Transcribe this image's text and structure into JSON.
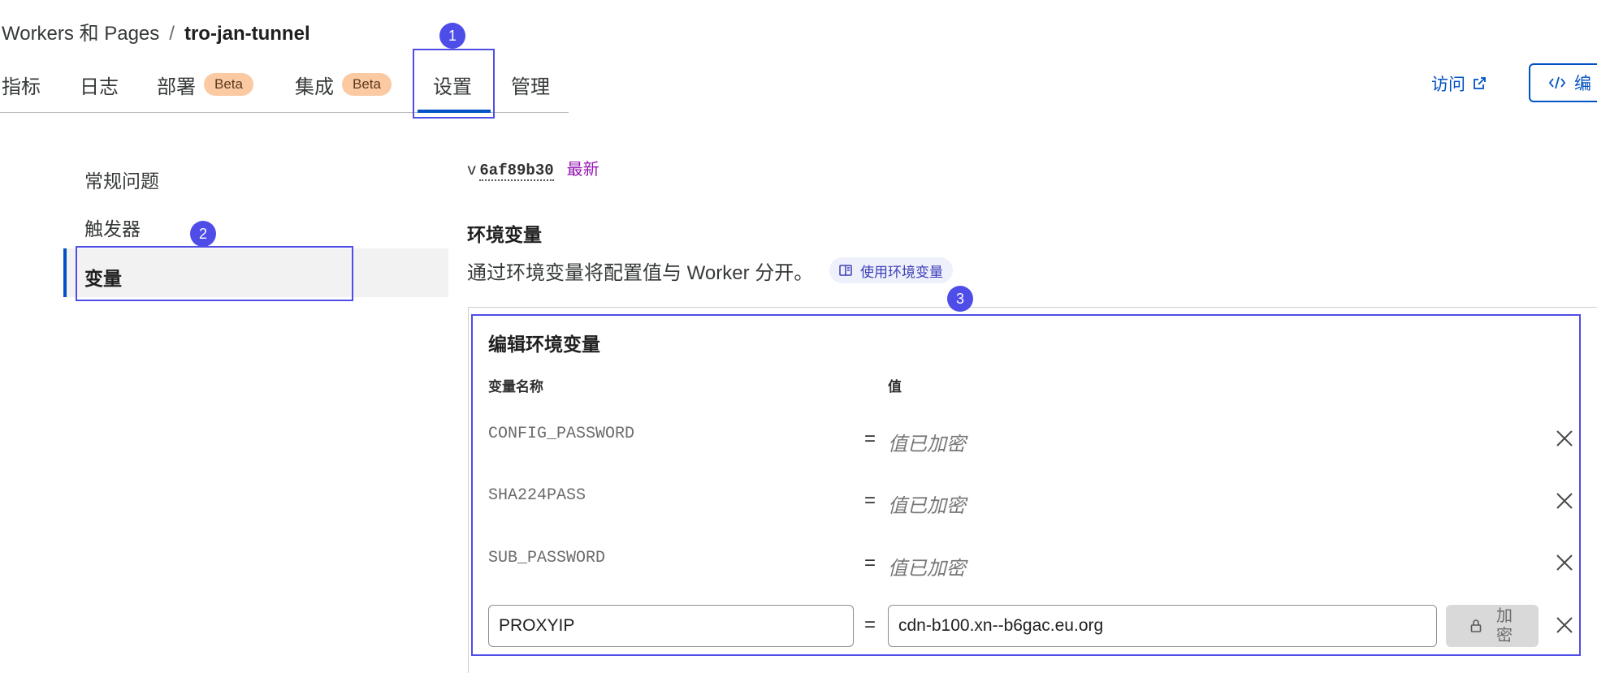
{
  "breadcrumb": {
    "parent": "Workers 和 Pages",
    "separator": "/",
    "current": "tro-jan-tunnel"
  },
  "tabs": [
    {
      "label": "指标"
    },
    {
      "label": "日志"
    },
    {
      "label": "部署",
      "badge": "Beta"
    },
    {
      "label": "集成",
      "badge": "Beta"
    },
    {
      "label": "设置",
      "active": true
    },
    {
      "label": "管理"
    }
  ],
  "header_actions": {
    "visit_label": "访问",
    "edit_label": "编"
  },
  "sidebar": {
    "items": [
      {
        "label": "常规问题"
      },
      {
        "label": "触发器"
      },
      {
        "label": "变量",
        "active": true
      }
    ]
  },
  "version": {
    "prefix": "v",
    "hash": "6af89b30",
    "tag": "最新"
  },
  "env_section": {
    "title": "环境变量",
    "description": "通过环境变量将配置值与 Worker 分开。",
    "docs_link": "使用环境变量"
  },
  "editor": {
    "title": "编辑环境变量",
    "col_name": "变量名称",
    "col_value": "值",
    "equals": "=",
    "rows": [
      {
        "name": "CONFIG_PASSWORD",
        "value": "值已加密"
      },
      {
        "name": "SHA224PASS",
        "value": "值已加密"
      },
      {
        "name": "SUB_PASSWORD",
        "value": "值已加密"
      }
    ],
    "edit_row": {
      "name": "PROXYIP",
      "value": "cdn-b100.xn--b6gac.eu.org",
      "encrypt_label": "加密"
    }
  },
  "annotations": [
    "1",
    "2",
    "3"
  ],
  "colors": {
    "accent": "#0051c3",
    "annotation": "#4f4de8",
    "badge_bg": "#fbc9a2",
    "latest": "#9616b2"
  },
  "icons": [
    "external-link-icon",
    "code-icon",
    "book-icon",
    "close-icon",
    "lock-icon"
  ]
}
